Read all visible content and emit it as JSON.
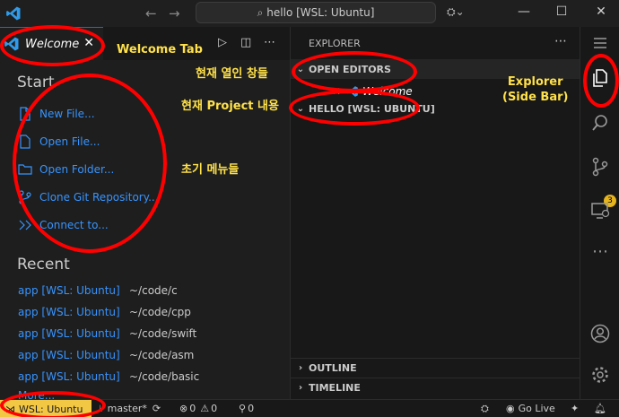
{
  "titlebar": {
    "search_text": "hello [WSL: Ubuntu]",
    "back_icon": "arrow-left-icon",
    "forward_icon": "arrow-right-icon",
    "minimize": "—",
    "maximize": "☐",
    "close": "✕"
  },
  "editor": {
    "tab_label": "Welcome",
    "start_title": "Start",
    "start_items": [
      {
        "label": "New File...",
        "icon": "new-file-icon"
      },
      {
        "label": "Open File...",
        "icon": "open-file-icon"
      },
      {
        "label": "Open Folder...",
        "icon": "folder-icon"
      },
      {
        "label": "Clone Git Repository...",
        "icon": "git-clone-icon"
      },
      {
        "label": "Connect to...",
        "icon": "remote-connect-icon"
      }
    ],
    "recent_title": "Recent",
    "recent_items": [
      {
        "name": "app [WSL: Ubuntu]",
        "path": "~/code/c"
      },
      {
        "name": "app [WSL: Ubuntu]",
        "path": "~/code/cpp"
      },
      {
        "name": "app [WSL: Ubuntu]",
        "path": "~/code/swift"
      },
      {
        "name": "app [WSL: Ubuntu]",
        "path": "~/code/asm"
      },
      {
        "name": "app [WSL: Ubuntu]",
        "path": "~/code/basic"
      }
    ],
    "more_label": "More..."
  },
  "sidebar": {
    "header": "EXPLORER",
    "open_editors": "OPEN EDITORS",
    "open_file": "Welcome",
    "project": "HELLO [WSL: UBUNTU]",
    "outline": "OUTLINE",
    "timeline": "TIMELINE"
  },
  "activitybar": {
    "scm_badge": "3"
  },
  "statusbar": {
    "remote": "WSL: Ubuntu",
    "branch": "master*",
    "errors": "0",
    "warnings": "0",
    "ports": "0",
    "golive": "Go Live"
  },
  "annotations": {
    "welcome_tab": "Welcome Tab",
    "open_windows": "현재 열인 창들",
    "project_content": "현재 Project 내용",
    "initial_menu": "초기 메뉴들",
    "explorer_line1": "Explorer",
    "explorer_line2": "(Side Bar)"
  },
  "colors": {
    "accent": "#0078d4",
    "link": "#3794ff",
    "annotation_red": "#ff0000",
    "annotation_text": "#ffe14a",
    "remote_bg": "#f2c744"
  }
}
